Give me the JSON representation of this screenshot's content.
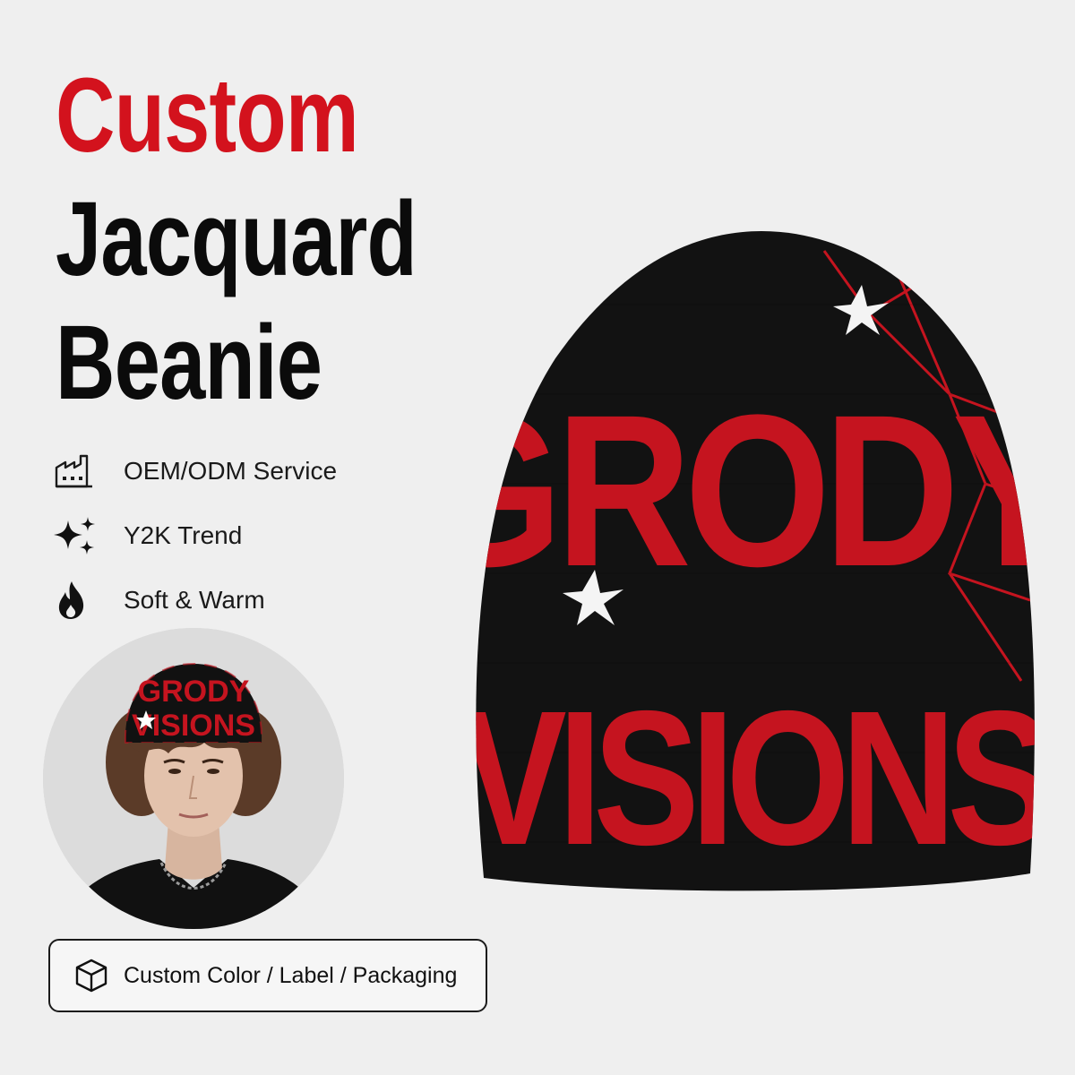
{
  "headline": {
    "line1": "Custom",
    "line2": "Jacquard",
    "line3": "Beanie"
  },
  "features": [
    {
      "icon": "factory-icon",
      "label": "OEM/ODM Service"
    },
    {
      "icon": "sparkles-icon",
      "label": "Y2K Trend"
    },
    {
      "icon": "flame-icon",
      "label": "Soft & Warm"
    }
  ],
  "customization": {
    "icon": "box-icon",
    "label": "Custom Color / Label / Packaging"
  },
  "product": {
    "pattern_text_top": "GRODY",
    "pattern_text_bottom": "VISIONS"
  },
  "colors": {
    "accent_red": "#d3121d",
    "knit_black": "#111111",
    "background": "#efefef"
  }
}
